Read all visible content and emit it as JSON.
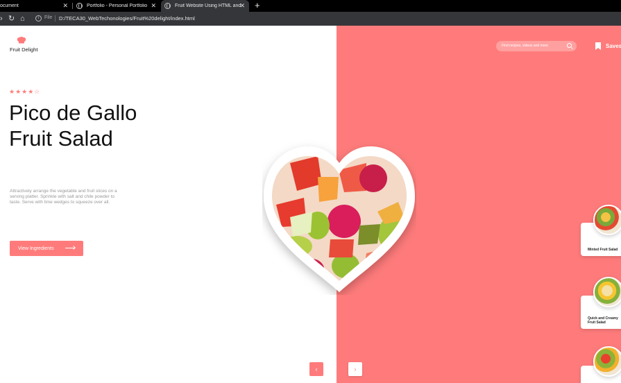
{
  "browser": {
    "tabs": [
      {
        "title": "ocument",
        "active": false
      },
      {
        "title": "Portfolio - Personal Portfolio",
        "active": false
      },
      {
        "title": "Fruit Website Using HTML and CS",
        "active": true
      }
    ],
    "new_tab_label": "+",
    "address": {
      "scheme_label": "File",
      "url": "D:/TECA30_WebTechonologies/Fruit%20delight/index.html"
    }
  },
  "site": {
    "brand": "Fruit Delight",
    "search_placeholder": "Find recipes, videos and more",
    "saves_label": "Saves"
  },
  "hero": {
    "rating": 4,
    "rating_max": 5,
    "stars_text": "★★★★☆",
    "title": "Pico de Gallo Fruit Salad",
    "description": "Attractively arrange the vegetable and fruit slices on a serving platter. Sprinkle with salt and chile powder to taste. Serve with lime wedges to squeeze over all.",
    "cta_label": "View Ingredients"
  },
  "recipes": [
    {
      "name": "Minted Fruit Salad"
    },
    {
      "name": "Quick and Creamy Fruit Salad"
    },
    {
      "name": ""
    }
  ],
  "carousel": {
    "prev": "‹",
    "next": "›"
  },
  "colors": {
    "accent": "#ff7b7b",
    "chrome_dark": "#35363a"
  }
}
